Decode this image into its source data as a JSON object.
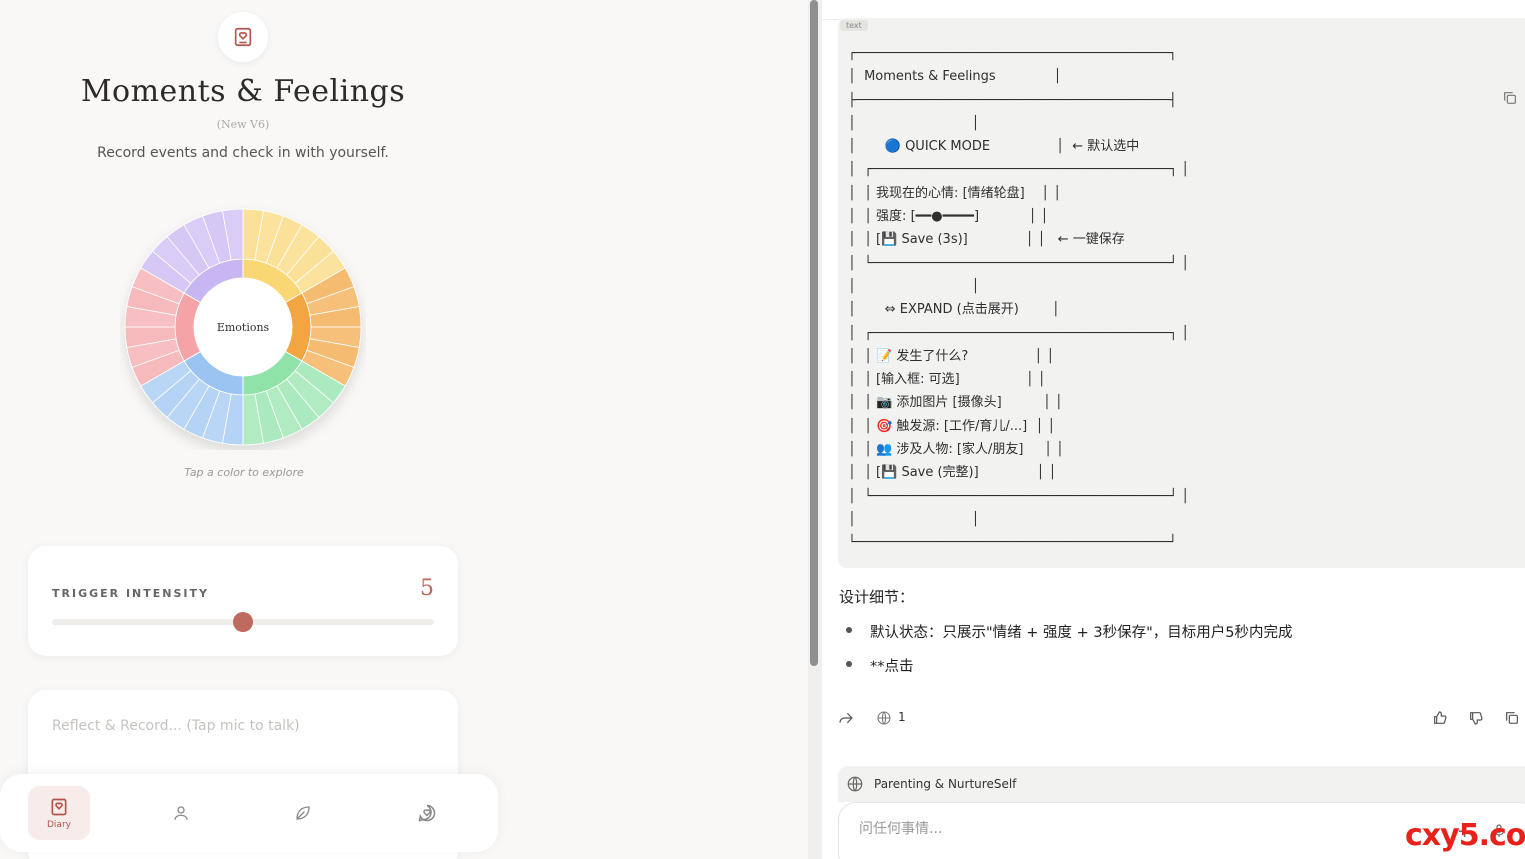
{
  "app": {
    "title": "Moments & Feelings",
    "version": "(New V6)",
    "subtitle": "Record events and check in with yourself.",
    "wheel_center_label": "Emotions",
    "tap_hint": "Tap a color to explore",
    "intensity": {
      "label": "TRIGGER INTENSITY",
      "value": "5",
      "level": 5,
      "max": 10
    },
    "reflect_placeholder": "Reflect & Record... (Tap mic to talk)",
    "nav": {
      "diary_label": "Diary"
    }
  },
  "colors": {
    "accent": "#bf6a5e",
    "segments": [
      "#f9d774",
      "#f2a541",
      "#8fe3a8",
      "#9cc4f2",
      "#f4a3a6",
      "#c8b6f2"
    ]
  },
  "chat": {
    "code_lang": "text",
    "ascii_lines": [
      "┌────────────────────────────────────────┐",
      "│  Moments & Feelings              │",
      "├────────────────────────────────────────┤",
      "│                            │",
      "│       🔵 QUICK MODE                │  ← 默认选中",
      "│  ┌──────────────────────────────────────┐ │",
      "│  │ 我现在的心情: [情绪轮盘]    │ │",
      "│  │ 强度: [━━●━━━━]            │ │",
      "│  │ [💾 Save (3s)]              │ │   ← 一键保存",
      "│  └──────────────────────────────────────┘ │",
      "│                            │",
      "│       ⇔ EXPAND (点击展开)        │",
      "│  ┌──────────────────────────────────────┐ │",
      "│  │ 📝 发生了什么?                │ │",
      "│  │ [输入框: 可选]                │ │",
      "│  │ 📷 添加图片 [摄像头]          │ │",
      "│  │ 🎯 触发源: [工作/育儿/...]  │ │",
      "│  │ 👥 涉及人物: [家人/朋友]     │ │",
      "│  │ [💾 Save (完整)]              │ │",
      "│  └──────────────────────────────────────┘ │",
      "│                            │",
      "└────────────────────────────────────────┘"
    ],
    "details_heading": "设计细节：",
    "bullets": [
      "默认状态：只展示\"情绪 + 强度 + 3秒保存\"，目标用户5秒内完成",
      "**点击"
    ],
    "cite_count": "1",
    "context_label": "Parenting & NurtureSelf",
    "input_placeholder": "问任何事情..."
  },
  "watermark": "cxy5.com"
}
